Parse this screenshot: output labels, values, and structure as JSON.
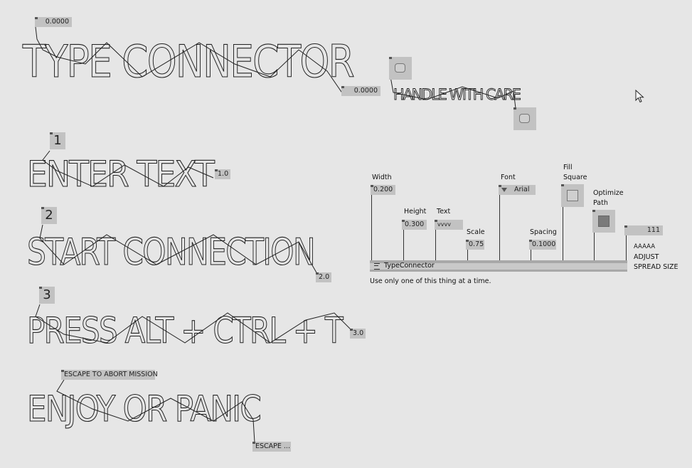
{
  "titles": {
    "type_connector": "TYPE CONNECTOR",
    "handle_with_care": "HANDLE WITH CARE",
    "enter_text": "ENTER TEXT",
    "start_connection": "START CONNECTION",
    "press_keys": "PRESS ALT + CTRL + T",
    "enjoy_or_panic": "ENJOY OR PANIC"
  },
  "boxes": {
    "top_value_1": "0.0000",
    "top_value_2": "0.0000",
    "step1": "1",
    "step2": "2",
    "step3": "3",
    "step1_value": "1.0",
    "step2_value": "2.0",
    "step3_value": "3.0",
    "escape_top": "ESCAPE TO ABORT MISSION",
    "escape_bottom": "ESCAPE ..."
  },
  "node": {
    "name": "TypeConnector",
    "note": "Use only one of this thing at a time.",
    "pins": {
      "width_label": "Width",
      "width_value": "0.200",
      "height_label": "Height",
      "height_value": "0.300",
      "text_label": "Text",
      "text_value": "vvvv",
      "scale_label": "Scale",
      "scale_value": "0.75",
      "font_label": "Font",
      "font_value": "Arial",
      "spacing_label": "Spacing",
      "spacing_value": "0.1000",
      "fill_label_1": "Fill",
      "fill_label_2": "Square",
      "optimize_label_1": "Optimize",
      "optimize_label_2": "Path",
      "spread_value": "111",
      "spread_label_1": "AAAAA",
      "spread_label_2": "ADJUST",
      "spread_label_3": "SPREAD SIZE"
    }
  },
  "toggles": {
    "fill_square": false,
    "optimize_path": true
  },
  "icons": {
    "cursor": "arrow-cursor-icon",
    "menu": "node-menu-icon",
    "enum": "dropdown-arrow-icon"
  }
}
